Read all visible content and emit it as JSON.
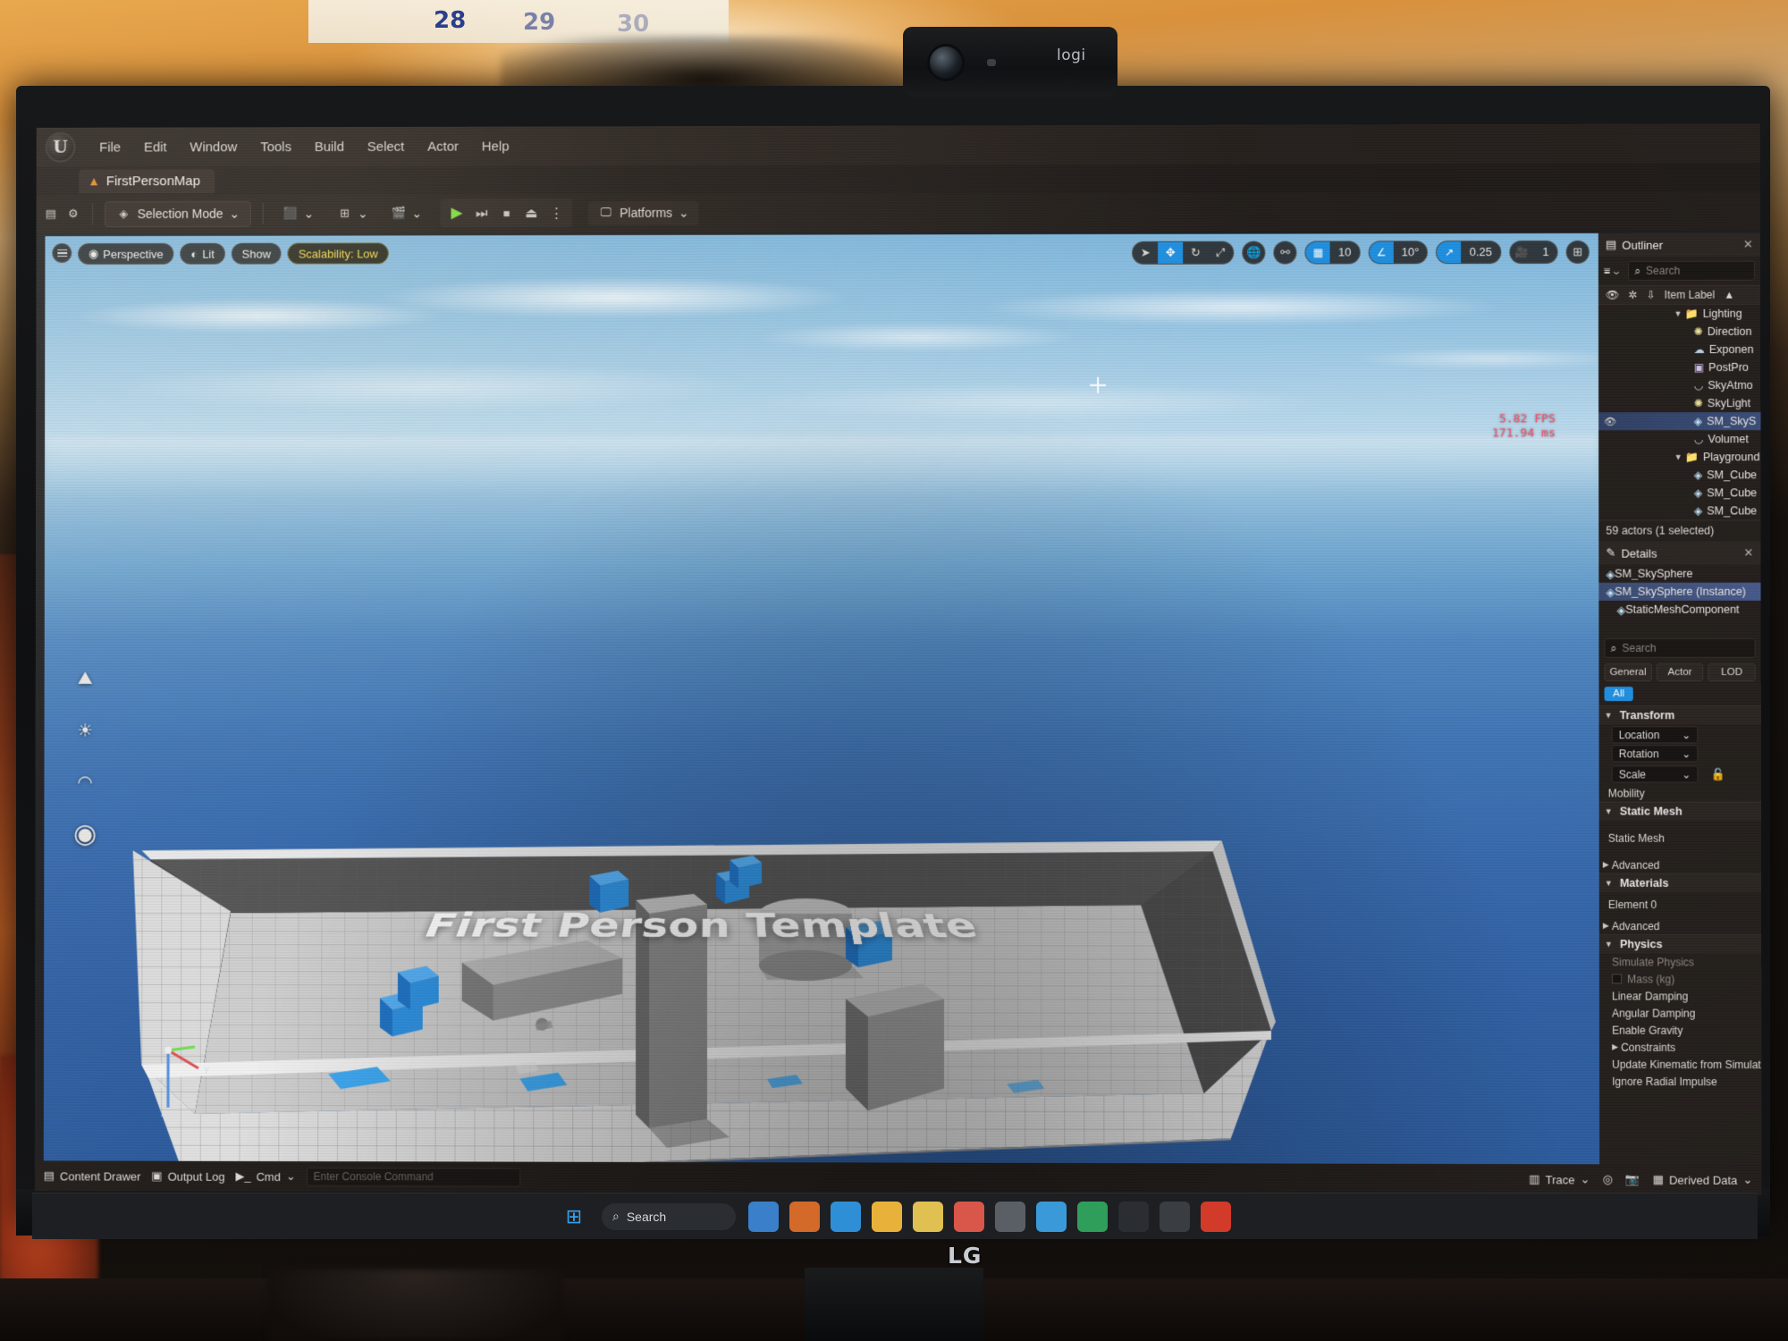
{
  "room": {
    "calendar_numbers": [
      "28",
      "29",
      "30"
    ],
    "webcam_brand": "logi",
    "monitor_brand": "LG"
  },
  "app": {
    "menu": [
      "File",
      "Edit",
      "Window",
      "Tools",
      "Build",
      "Select",
      "Actor",
      "Help"
    ],
    "level_tab": "FirstPersonMap",
    "toolbar": {
      "selection_mode": "Selection Mode",
      "platforms": "Platforms",
      "add_icon": "add-actor-icon",
      "blueprint_icon": "blueprints-icon",
      "cinematics_icon": "cinematics-icon",
      "play_icon": "play-icon",
      "skip_icon": "skip-icon",
      "stop_icon": "stop-icon",
      "eject_icon": "eject-icon",
      "more_icon": "more-options-icon",
      "save_icon": "save-icon",
      "settings_icon": "settings-icon"
    }
  },
  "viewport": {
    "overlay": {
      "menu_icon": "viewport-menu-icon",
      "perspective": "Perspective",
      "lit": "Lit",
      "show": "Show",
      "scalability": "Scalability: Low"
    },
    "gizmo": {
      "select_icon": "select-arrow-icon",
      "move_icon": "move-gizmo-icon",
      "rotate_icon": "rotate-gizmo-icon",
      "scale_icon": "scale-gizmo-icon",
      "world_icon": "world-coords-icon",
      "surface_snap_icon": "surface-snap-icon",
      "grid_snap_value": "10",
      "angle_snap_value": "10°",
      "scale_snap_value": "0.25",
      "camera_speed_value": "1",
      "maximize_icon": "maximize-viewport-icon"
    },
    "stats": {
      "fps": "5.82 FPS",
      "frametime": "171.94 ms"
    },
    "level_title": "First Person Template",
    "left_tools": [
      "landscape-icon",
      "lighting-icon",
      "eye-icon",
      "spotlight-icon"
    ]
  },
  "outliner": {
    "title": "Outliner",
    "close_icon": "close-icon",
    "search_placeholder": "Search",
    "filter_icon": "filter-icon",
    "columns": {
      "visibility": "eye-icon",
      "pin": "pin-icon",
      "type": "type-icon",
      "label": "Item Label"
    },
    "items": [
      {
        "label": "Lighting",
        "icon": "folder",
        "indent": 1,
        "caret": true,
        "selected": false
      },
      {
        "label": "Direction",
        "icon": "light",
        "indent": 2,
        "caret": false,
        "selected": false
      },
      {
        "label": "Exponen",
        "icon": "fog",
        "indent": 2,
        "caret": false,
        "selected": false
      },
      {
        "label": "PostPro",
        "icon": "pp",
        "indent": 2,
        "caret": false,
        "selected": false
      },
      {
        "label": "SkyAtmo",
        "icon": "atmo",
        "indent": 2,
        "caret": false,
        "selected": false
      },
      {
        "label": "SkyLight",
        "icon": "light",
        "indent": 2,
        "caret": false,
        "selected": false
      },
      {
        "label": "SM_SkyS",
        "icon": "mesh",
        "indent": 2,
        "caret": false,
        "selected": true
      },
      {
        "label": "Volumet",
        "icon": "atmo",
        "indent": 2,
        "caret": false,
        "selected": false
      },
      {
        "label": "Playground",
        "icon": "folder",
        "indent": 1,
        "caret": true,
        "selected": false
      },
      {
        "label": "SM_Cube",
        "icon": "mesh",
        "indent": 2,
        "caret": false,
        "selected": false
      },
      {
        "label": "SM_Cube",
        "icon": "mesh",
        "indent": 2,
        "caret": false,
        "selected": false
      },
      {
        "label": "SM_Cube",
        "icon": "mesh",
        "indent": 2,
        "caret": false,
        "selected": false
      }
    ],
    "actor_count": "59 actors (1 selected)"
  },
  "details": {
    "title": "Details",
    "close_icon": "close-icon",
    "actor_name": "SM_SkySphere",
    "components": [
      {
        "label": "SM_SkySphere (Instance)",
        "selected": true
      },
      {
        "label": "StaticMeshComponent",
        "selected": false
      }
    ],
    "search_placeholder": "Search",
    "tabs": [
      "General",
      "Actor",
      "LOD"
    ],
    "all_filter": "All",
    "sections": {
      "transform": {
        "title": "Transform",
        "rows": [
          "Location",
          "Rotation",
          "Scale"
        ],
        "lock_icon": "unlocked-icon",
        "mobility": "Mobility"
      },
      "static_mesh": {
        "title": "Static Mesh",
        "row": "Static Mesh",
        "advanced": "Advanced"
      },
      "materials": {
        "title": "Materials",
        "element": "Element 0",
        "advanced": "Advanced"
      },
      "physics": {
        "title": "Physics",
        "rows": [
          {
            "label": "Simulate Physics",
            "dim": true,
            "checkbox": false
          },
          {
            "label": "Mass (kg)",
            "dim": true,
            "checkbox": true
          },
          {
            "label": "Linear Damping",
            "dim": false,
            "checkbox": false
          },
          {
            "label": "Angular Damping",
            "dim": false,
            "checkbox": false
          },
          {
            "label": "Enable Gravity",
            "dim": false,
            "checkbox": false
          },
          {
            "label": "Constraints",
            "dim": false,
            "checkbox": false,
            "caret": true
          },
          {
            "label": "Update Kinematic from Simulation",
            "dim": false,
            "checkbox": false
          },
          {
            "label": "Ignore Radial Impulse",
            "dim": false,
            "checkbox": false
          }
        ]
      }
    }
  },
  "statusbar": {
    "content_drawer": "Content Drawer",
    "output_log": "Output Log",
    "cmd": "Cmd",
    "console_placeholder": "Enter Console Command",
    "trace": "Trace",
    "derived_data": "Derived Data",
    "source_control_icon": "source-control-icon",
    "camera_icon": "camera-icon"
  },
  "taskbar": {
    "start_icon": "windows-start-icon",
    "search_label": "Search",
    "apps": [
      "widgets-icon",
      "paint-icon",
      "store-icon",
      "files-icon",
      "folder-icon",
      "chrome-icon",
      "settings-icon",
      "info-icon",
      "excel-icon",
      "unreal-launcher-icon",
      "unreal-engine-icon",
      "app-icon"
    ]
  }
}
